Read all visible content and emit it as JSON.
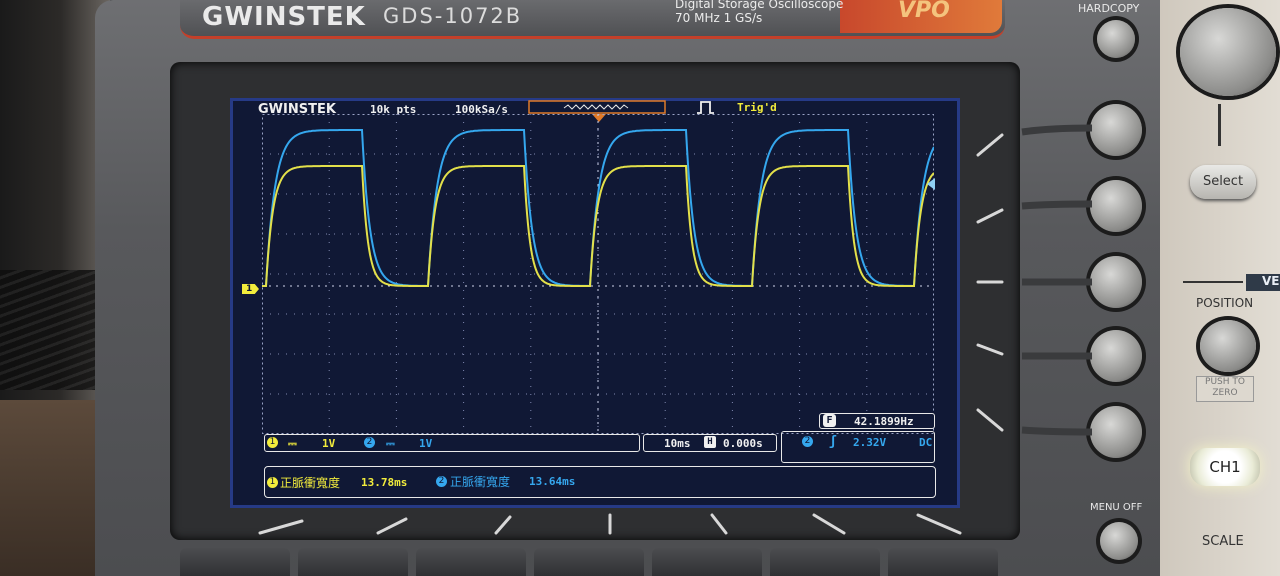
{
  "brand": {
    "logo": "GWINSTEK",
    "model": "GDS-1072B",
    "description_line1": "Digital Storage Oscilloscope",
    "description_line2": "70 MHz  1 GS/s",
    "badge": "VPO"
  },
  "panel": {
    "hardcopy_label": "HARDCOPY",
    "select_label": "Select",
    "vertical_label": "VE",
    "position_label": "POSITION",
    "push_to_zero_line1": "PUSH TO",
    "push_to_zero_line2": "ZERO",
    "menu_off_label": "MENU OFF",
    "ch1_label": "CH1",
    "scale_label": "SCALE"
  },
  "screen": {
    "logo": "GWINSTEK",
    "record_length": "10k pts",
    "sample_rate": "100kSa/s",
    "trigger_status": "Trig'd",
    "channel_marker": "1",
    "ch1_number": "1",
    "ch1_coupling_symbol": "⎓",
    "ch1_scale": "1V",
    "ch2_number": "2",
    "ch2_coupling_symbol": "⎓",
    "ch2_scale": "1V",
    "timebase": "10ms",
    "horizontal_symbol": "H",
    "horizontal_position": "0.000s",
    "trigger_source": "2",
    "trigger_slope": "ʃ",
    "trigger_level": "2.32V",
    "trigger_coupling": "DC",
    "frequency_label": "F",
    "frequency_value": "42.1899Hz",
    "measurement_1_channel": "1",
    "measurement_1_label": "正脈衝寬度",
    "measurement_1_value": "13.78ms",
    "measurement_2_channel": "2",
    "measurement_2_label": "正脈衝寬度",
    "measurement_2_value": "13.64ms",
    "colors": {
      "ch1": "#f2ec3c",
      "ch2": "#35a7ee",
      "background": "#101835",
      "text": "#f0f0f0"
    }
  }
}
